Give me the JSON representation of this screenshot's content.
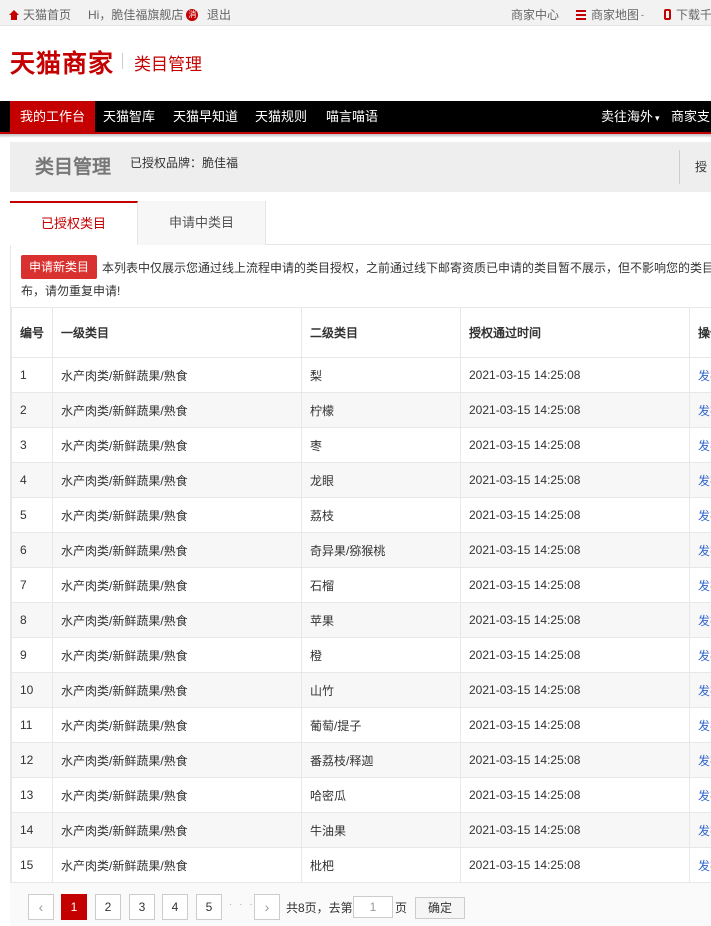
{
  "topbar": {
    "home": "天猫首页",
    "greeting": "Hi，脆佳福旗舰店",
    "message_badge": "消",
    "logout": "退出",
    "merchant_center": "商家中心",
    "merchant_map": "商家地图",
    "download": "下载千"
  },
  "header": {
    "logo": "天猫商家",
    "subtitle": "类目管理"
  },
  "nav": {
    "items": [
      "我的工作台",
      "天猫智库",
      "天猫早知道",
      "天猫规则",
      "喵言喵语"
    ],
    "right_items": [
      "卖往海外",
      "商家支"
    ]
  },
  "titleband": {
    "title": "类目管理",
    "brand_label": "已授权品牌：脆佳福",
    "truncated_right": "授"
  },
  "tabs": [
    "已授权类目",
    "申请中类目"
  ],
  "notice": {
    "apply_button": "申请新类目",
    "line1": "本列表中仅展示您通过线上流程申请的类目授权，之前通过线下邮寄资质已申请的类目暂不展示，但不影响您的类目",
    "line2": "布，请勿重复申请!"
  },
  "table": {
    "headers": [
      "编号",
      "一级类目",
      "二级类目",
      "授权通过时间",
      "操作"
    ],
    "rows": [
      [
        "1",
        "水产肉类/新鲜蔬果/熟食",
        "梨",
        "2021-03-15 14:25:08",
        "发布"
      ],
      [
        "2",
        "水产肉类/新鲜蔬果/熟食",
        "柠檬",
        "2021-03-15 14:25:08",
        "发布"
      ],
      [
        "3",
        "水产肉类/新鲜蔬果/熟食",
        "枣",
        "2021-03-15 14:25:08",
        "发布"
      ],
      [
        "4",
        "水产肉类/新鲜蔬果/熟食",
        "龙眼",
        "2021-03-15 14:25:08",
        "发布"
      ],
      [
        "5",
        "水产肉类/新鲜蔬果/熟食",
        "荔枝",
        "2021-03-15 14:25:08",
        "发布"
      ],
      [
        "6",
        "水产肉类/新鲜蔬果/熟食",
        "奇异果/猕猴桃",
        "2021-03-15 14:25:08",
        "发布"
      ],
      [
        "7",
        "水产肉类/新鲜蔬果/熟食",
        "石榴",
        "2021-03-15 14:25:08",
        "发布"
      ],
      [
        "8",
        "水产肉类/新鲜蔬果/熟食",
        "苹果",
        "2021-03-15 14:25:08",
        "发布"
      ],
      [
        "9",
        "水产肉类/新鲜蔬果/熟食",
        "橙",
        "2021-03-15 14:25:08",
        "发布"
      ],
      [
        "10",
        "水产肉类/新鲜蔬果/熟食",
        "山竹",
        "2021-03-15 14:25:08",
        "发布"
      ],
      [
        "11",
        "水产肉类/新鲜蔬果/熟食",
        "葡萄/提子",
        "2021-03-15 14:25:08",
        "发布"
      ],
      [
        "12",
        "水产肉类/新鲜蔬果/熟食",
        "番荔枝/释迦",
        "2021-03-15 14:25:08",
        "发布"
      ],
      [
        "13",
        "水产肉类/新鲜蔬果/熟食",
        "哈密瓜",
        "2021-03-15 14:25:08",
        "发布"
      ],
      [
        "14",
        "水产肉类/新鲜蔬果/熟食",
        "牛油果",
        "2021-03-15 14:25:08",
        "发布"
      ],
      [
        "15",
        "水产肉类/新鲜蔬果/熟食",
        "枇杷",
        "2021-03-15 14:25:08",
        "发布"
      ]
    ]
  },
  "pagination": {
    "prev": "‹",
    "pages": [
      "1",
      "2",
      "3",
      "4",
      "5"
    ],
    "current": "1",
    "ellipsis": "· · ·",
    "next": "›",
    "total_text": "共8页，去第",
    "input_value": "1",
    "page_unit": "页",
    "confirm": "确定"
  },
  "colors": {
    "brand_red": "#c40000",
    "link_blue": "#3366cc",
    "nav_black": "#000000"
  }
}
